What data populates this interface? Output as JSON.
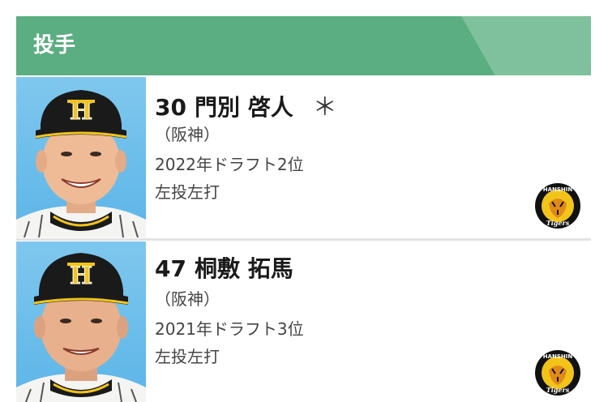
{
  "header": {
    "title": "投手"
  },
  "players": [
    {
      "number": "30",
      "name": "門別 啓人",
      "mark": "＊",
      "team": "（阪神）",
      "draft": "2022年ドラフト2位",
      "throws_bats": "左投左打",
      "logo_text_top": "HANSHIN",
      "logo_text_bottom": "Tigers"
    },
    {
      "number": "47",
      "name": "桐敷 拓馬",
      "mark": "",
      "team": "（阪神）",
      "draft": "2021年ドラフト3位",
      "throws_bats": "左投左打",
      "logo_text_top": "HANSHIN",
      "logo_text_bottom": "Tigers"
    }
  ],
  "colors": {
    "header_green": "#5aae81",
    "cap_black": "#1a1a1a",
    "cap_gold": "#f2c41a",
    "photo_sky": "#6dbcec"
  }
}
